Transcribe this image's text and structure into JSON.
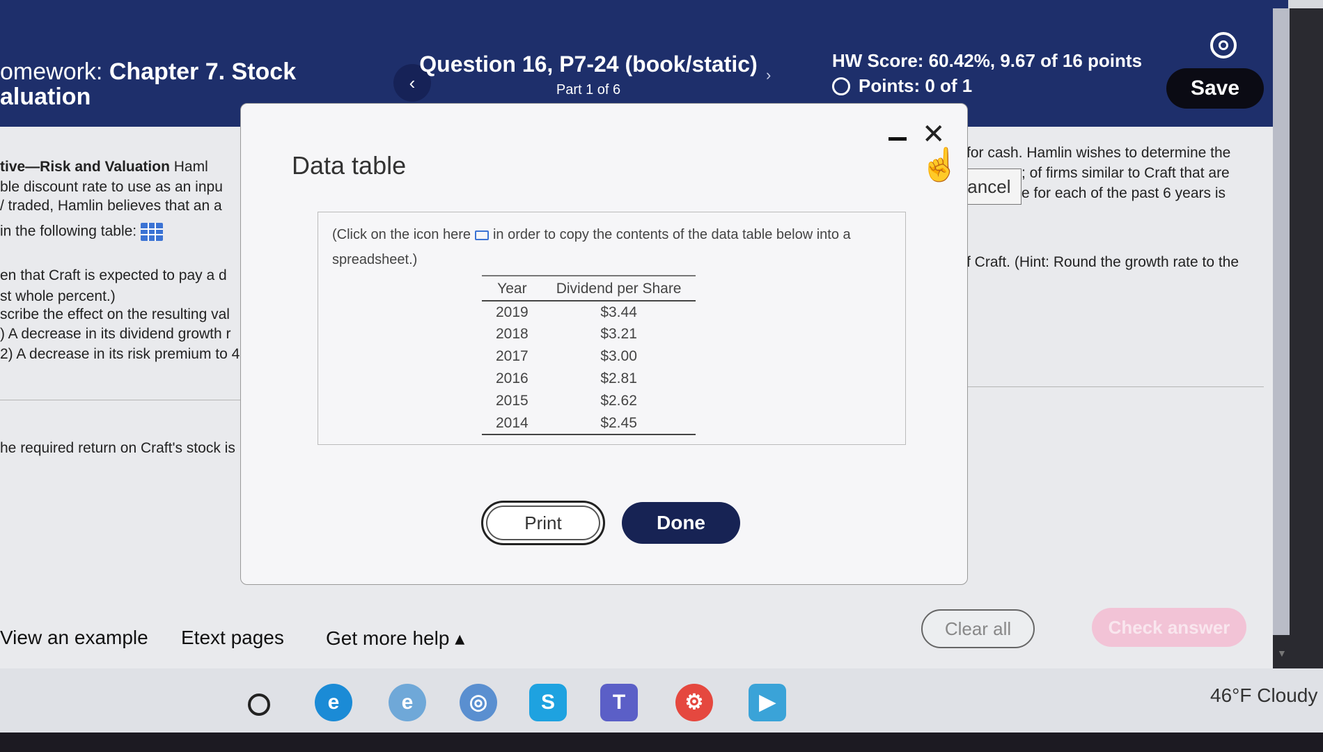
{
  "header": {
    "hw_prefix": "omework: ",
    "hw_title_1": "Chapter 7. Stock",
    "hw_title_2": "aluation",
    "question_title": "Question 16, P7-24 (book/static)",
    "part": "Part 1 of 6",
    "prev_glyph": "‹",
    "next_glyph": "›",
    "hw_score": "HW Score: 60.42%, 9.67 of 16 points",
    "points": "Points: 0 of 1",
    "save_label": "Save"
  },
  "left_text": {
    "line1_bold": "tive—Risk and Valuation",
    "line1_rest": "  Haml",
    "line2": "ble discount rate to use as an inpu",
    "line3": "/ traded, Hamlin believes that an a",
    "line4": " in the following table:",
    "line5": "en that Craft is expected to pay a d",
    "line6": "st whole percent.)",
    "line7": "scribe the effect on the resulting val",
    "line8": ") A decrease in its dividend growth r",
    "line9": "2) A decrease in its risk premium to 4",
    "line10": "he required return on Craft's stock is"
  },
  "right_text": {
    "line1": "for cash.  Hamlin wishes to determine the",
    "line2": "; of firms similar to Craft that are",
    "line3": "e for each of the past 6 years is",
    "line4": "f Craft. (Hint: Round the growth rate to the",
    "cancel": "Cancel"
  },
  "modal": {
    "title": "Data table",
    "note_pre": "(Click on the icon here",
    "note_post": "in order to copy the contents of the data table below into a spreadsheet.)",
    "col_year": "Year",
    "col_dividend": "Dividend per Share",
    "rows": [
      {
        "year": "2019",
        "dividend": "$3.44"
      },
      {
        "year": "2018",
        "dividend": "$3.21"
      },
      {
        "year": "2017",
        "dividend": "$3.00"
      },
      {
        "year": "2016",
        "dividend": "$2.81"
      },
      {
        "year": "2015",
        "dividend": "$2.62"
      },
      {
        "year": "2014",
        "dividend": "$2.45"
      }
    ],
    "print_label": "Print",
    "done_label": "Done",
    "close_glyph": "✕"
  },
  "footer": {
    "view_example": "View an example",
    "etext": "Etext pages",
    "more_help": "Get more help ▴",
    "clear_all": "Clear all",
    "check_answer": "Check answer"
  },
  "taskbar": {
    "weather": "46°F  Cloudy"
  },
  "colors": {
    "header_bg": "#1e2f6b",
    "done_bg": "#172354",
    "check_answer_bg": "#f2c3d6"
  }
}
